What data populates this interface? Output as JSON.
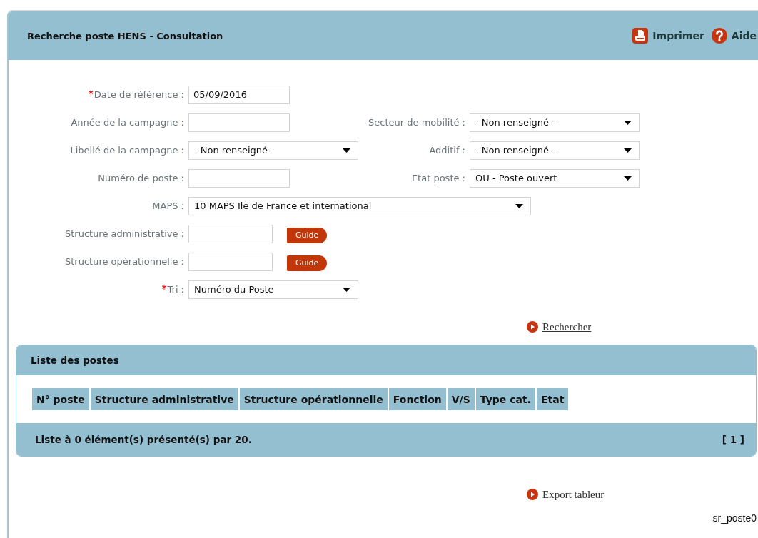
{
  "header": {
    "title": "Recherche poste HENS - Consultation",
    "actions": [
      {
        "kind": "print",
        "label": "Imprimer"
      },
      {
        "kind": "help",
        "label": "Aide"
      }
    ]
  },
  "form": {
    "rows": [
      {
        "left": {
          "label": "Date de référence :",
          "required": true,
          "kind": "text",
          "value": "05/09/2016"
        }
      },
      {
        "left": {
          "label": "Année de la campagne :",
          "required": false,
          "kind": "text"
        },
        "right": {
          "label": "Secteur de mobilité :",
          "required": false,
          "kind": "select",
          "value": "- Non renseigné -"
        }
      },
      {
        "left": {
          "label": "Libellé de la campagne :",
          "required": false,
          "kind": "select",
          "value": "- Non renseigné -"
        },
        "right": {
          "label": "Additif :",
          "required": false,
          "kind": "select",
          "value": "- Non renseigné -"
        }
      },
      {
        "left": {
          "label": "Numéro de poste :",
          "required": false,
          "kind": "text"
        },
        "right": {
          "label": "Etat poste :",
          "required": false,
          "kind": "select",
          "value": "OU - Poste ouvert"
        }
      },
      {
        "left": {
          "label": "MAPS :",
          "required": false,
          "kind": "wide-select",
          "value": "10 MAPS Ile de France et international"
        }
      },
      {
        "left": {
          "label": "Structure administrative :",
          "required": false,
          "kind": "lookup",
          "button": "Guide"
        }
      },
      {
        "left": {
          "label": "Structure opérationnelle :",
          "required": false,
          "kind": "lookup",
          "button": "Guide"
        }
      },
      {
        "left": {
          "label": "Tri :",
          "required": true,
          "kind": "select",
          "value": "Numéro du Poste"
        }
      }
    ]
  },
  "search_link": "Rechercher",
  "list": {
    "title": "Liste des postes",
    "columns": [
      "N° poste",
      "Structure administrative",
      "Structure opérationnelle",
      "Fonction",
      "V/S",
      "Type cat.",
      "Etat"
    ],
    "footer": "Liste à 0 élément(s) présenté(s) par 20.",
    "pagination": "[ 1 ]"
  },
  "export_link": "Export tableur",
  "screen_id": "sr_poste0"
}
